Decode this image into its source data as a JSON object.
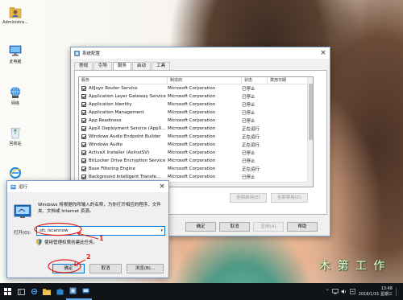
{
  "desktop": {
    "icons": [
      {
        "label": "Administra...",
        "icon": "user-folder-icon"
      },
      {
        "label": "此电脑",
        "icon": "computer-icon"
      },
      {
        "label": "网络",
        "icon": "network-icon"
      },
      {
        "label": "回收站",
        "icon": "recycle-bin-icon"
      },
      {
        "label": "",
        "icon": "ie-browser-icon"
      }
    ]
  },
  "syscfg": {
    "title": "系统配置",
    "tabs": [
      "常规",
      "引导",
      "服务",
      "启动",
      "工具"
    ],
    "active_tab": "服务",
    "columns": [
      "服务",
      "制造商",
      "状态",
      "禁用日期"
    ],
    "rows": [
      {
        "name": "AllJoyn Router Service",
        "maker": "Microsoft Corporation",
        "status": "已停止"
      },
      {
        "name": "Application Layer Gateway Service",
        "maker": "Microsoft Corporation",
        "status": "已停止"
      },
      {
        "name": "Application Identity",
        "maker": "Microsoft Corporation",
        "status": "已停止"
      },
      {
        "name": "Application Management",
        "maker": "Microsoft Corporation",
        "status": "已停止"
      },
      {
        "name": "App Readiness",
        "maker": "Microsoft Corporation",
        "status": "已停止"
      },
      {
        "name": "AppX Deployment Service (AppX...",
        "maker": "Microsoft Corporation",
        "status": "正在运行"
      },
      {
        "name": "Windows Audio Endpoint Builder",
        "maker": "Microsoft Corporation",
        "status": "正在运行"
      },
      {
        "name": "Windows Audio",
        "maker": "Microsoft Corporation",
        "status": "正在运行"
      },
      {
        "name": "ActiveX Installer (AxInstSV)",
        "maker": "Microsoft Corporation",
        "status": "已停止"
      },
      {
        "name": "BitLocker Drive Encryption Service",
        "maker": "Microsoft Corporation",
        "status": "已停止"
      },
      {
        "name": "Base Filtering Engine",
        "maker": "Microsoft Corporation",
        "status": "正在运行"
      },
      {
        "name": "Background Intelligent Transfe...",
        "maker": "Microsoft Corporation",
        "status": "已停止"
      }
    ],
    "enable_all": "全部启用(E)",
    "disable_all": "全部禁用(D)",
    "ok": "确定",
    "cancel": "取消",
    "apply": "应用(A)",
    "help": "帮助"
  },
  "run": {
    "title": "运行",
    "description": "Windows 将根据你所输入的名称，为你打开相应的程序、文件夹、文档或 Internet 资源。",
    "open_label": "打开(O):",
    "input_value": "sfc /scannow",
    "admin_note": "使用管理权限创建此任务。",
    "ok": "确定",
    "cancel": "取消",
    "browse": "浏览(B)..."
  },
  "annotations": {
    "step1": "1",
    "step2": "2",
    "color": "#e0211c"
  },
  "taskbar": {
    "time": "13:48",
    "date": "2018/1/31 星期三"
  },
  "watermark": "木 第 工 作"
}
